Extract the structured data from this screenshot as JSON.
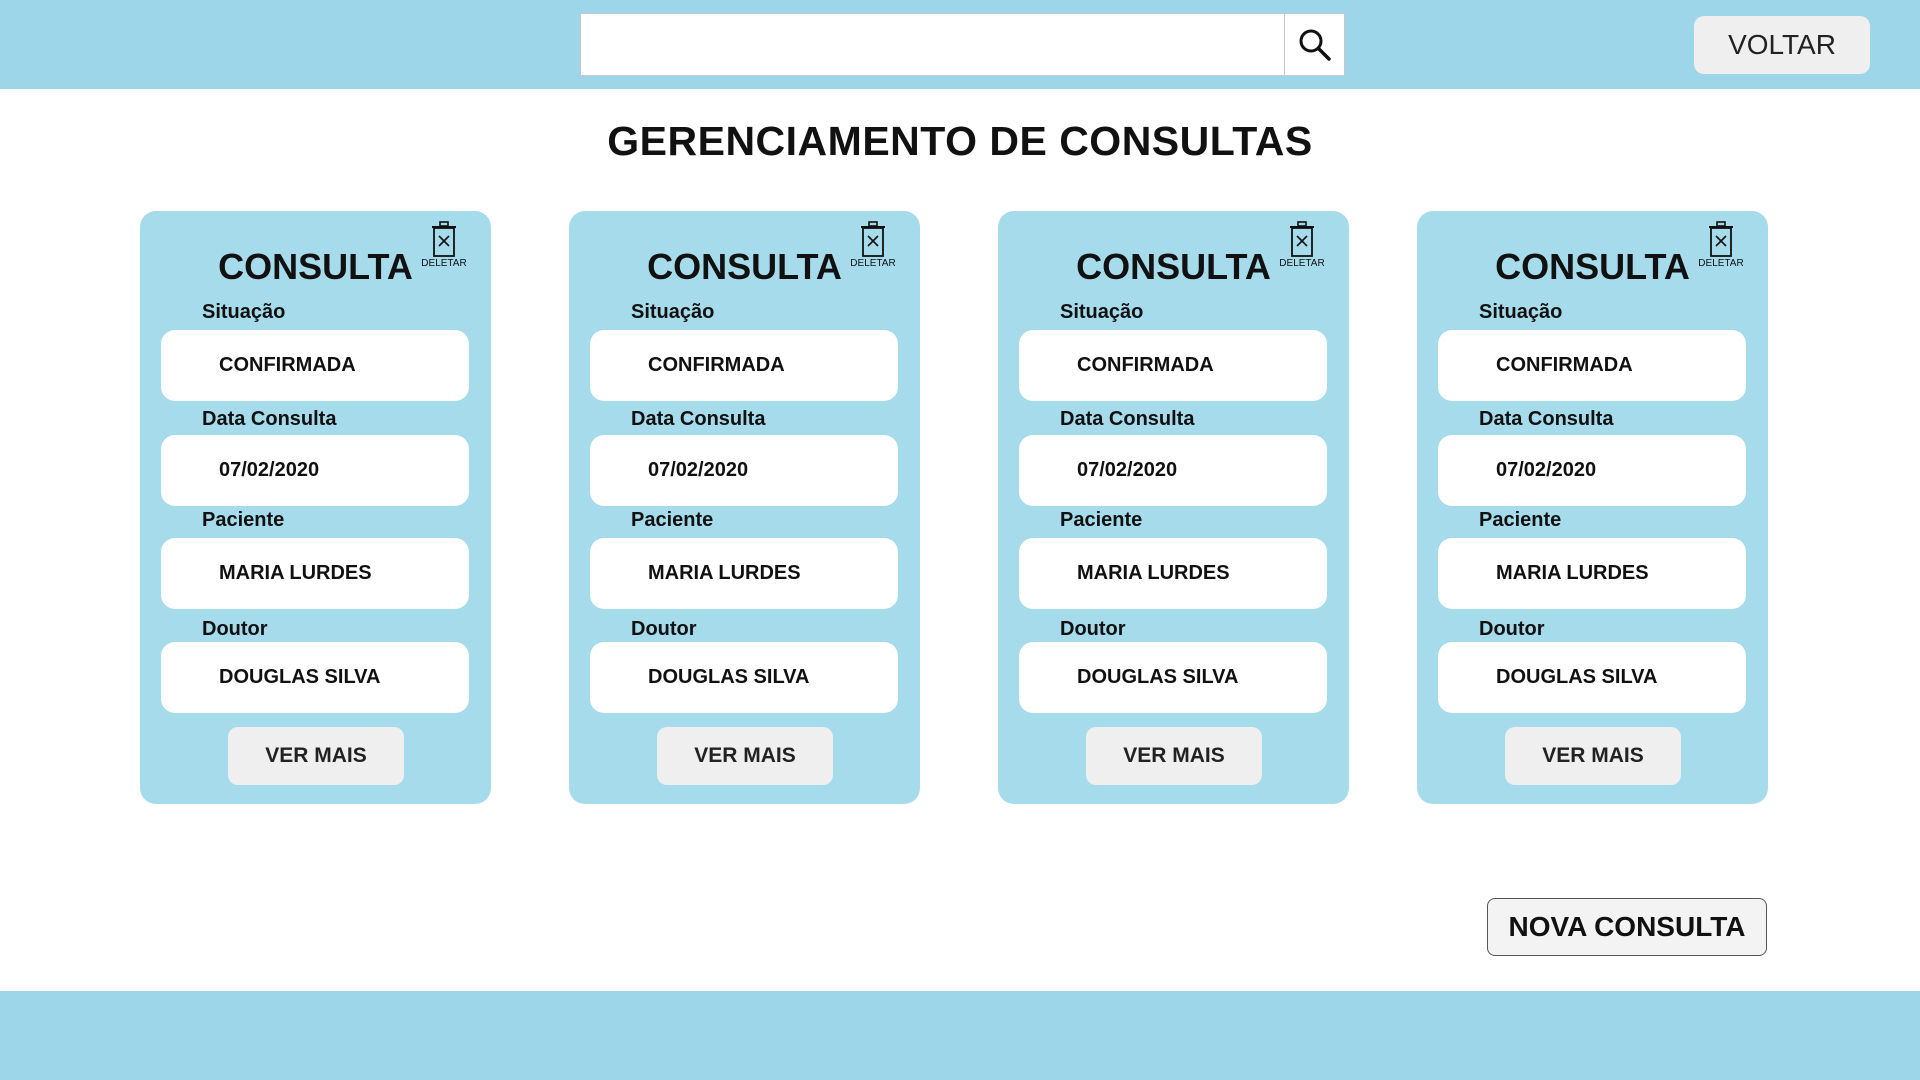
{
  "header": {
    "search": {
      "value": "",
      "placeholder": ""
    },
    "search_icon": "search-icon",
    "back_label": "VOLTAR"
  },
  "page_title": "GERENCIAMENTO DE CONSULTAS",
  "cards": [
    {
      "title": "CONSULTA",
      "delete_label": "DELETAR",
      "status_label": "Situação",
      "status": "CONFIRMADA",
      "date_label": "Data Consulta",
      "date": "07/02/2020",
      "patient_label": "Paciente",
      "patient": "MARIA LURDES",
      "doctor_label": "Doutor",
      "doctor": "DOUGLAS SILVA",
      "more_label": "VER MAIS"
    },
    {
      "title": "CONSULTA",
      "delete_label": "DELETAR",
      "status_label": "Situação",
      "status": "CONFIRMADA",
      "date_label": "Data Consulta",
      "date": "07/02/2020",
      "patient_label": "Paciente",
      "patient": "MARIA LURDES",
      "doctor_label": "Doutor",
      "doctor": "DOUGLAS SILVA",
      "more_label": "VER MAIS"
    },
    {
      "title": "CONSULTA",
      "delete_label": "DELETAR",
      "status_label": "Situação",
      "status": "CONFIRMADA",
      "date_label": "Data Consulta",
      "date": "07/02/2020",
      "patient_label": "Paciente",
      "patient": "MARIA LURDES",
      "doctor_label": "Doutor",
      "doctor": "DOUGLAS SILVA",
      "more_label": "VER MAIS"
    },
    {
      "title": "CONSULTA",
      "delete_label": "DELETAR",
      "status_label": "Situação",
      "status": "CONFIRMADA",
      "date_label": "Data Consulta",
      "date": "07/02/2020",
      "patient_label": "Paciente",
      "patient": "MARIA LURDES",
      "doctor_label": "Doutor",
      "doctor": "DOUGLAS SILVA",
      "more_label": "VER MAIS"
    }
  ],
  "new_button_label": "NOVA CONSULTA",
  "colors": {
    "bar": "#9dd6e9",
    "card": "#a6dbec",
    "button": "#efefef",
    "field": "#ffffff"
  }
}
